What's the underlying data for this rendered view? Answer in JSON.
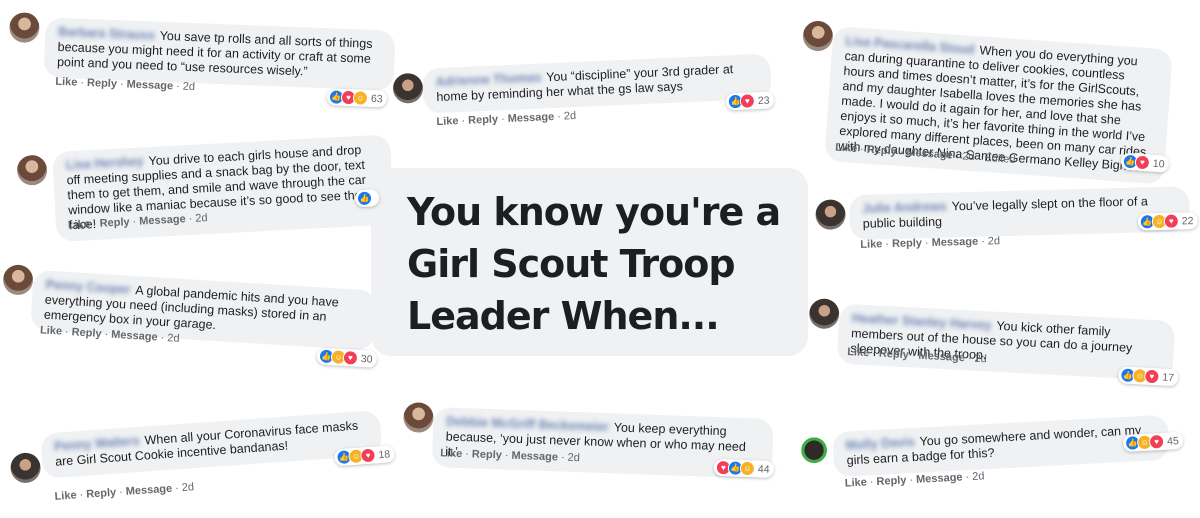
{
  "headline": [
    "You know you're a",
    "Girl Scout Troop",
    "Leader When..."
  ],
  "actions": {
    "like": "Like",
    "reply": "Reply",
    "message": "Message",
    "sep": "·"
  },
  "colors": {
    "like": "#1877f2",
    "love": "#f33e58",
    "haha": "#f7b125",
    "bubble": "#eff1f3"
  },
  "comments": [
    {
      "name": "Barbara Strauss",
      "text": "You save tp rolls and all sorts of things because you might need it for an activity or craft at some point and you need to “use resources wisely.”",
      "time": "2d",
      "reactions": [
        "like",
        "love",
        "haha"
      ],
      "count": "63"
    },
    {
      "name": "Adrienne Thomas",
      "text": "You “discipline” your 3rd grader at home by reminding her what the gs law says",
      "time": "2d",
      "reactions": [
        "like",
        "love"
      ],
      "count": "23"
    },
    {
      "name": "Lisa Pascarella Stoud",
      "text": "When you do everything you can during quarantine to deliver cookies, countless hours and times doesn’t matter, it’s for the GirlScouts, and my daughter Isabella loves the memories she has made. I would do it again for her, and love that she enjoys it so much, it’s her favorite thing in the world I’ve explored many different places, been on many car rides with my daughter Nina Santee Germano Kelley Bigness",
      "time": "2d · Edited",
      "reactions": [
        "like",
        "love"
      ],
      "count": "10"
    },
    {
      "name": "Lisa Hershey",
      "text": "You drive to each girls house and drop off meeting supplies and a snack bag by the door, text them to get them, and smile and wave through the car window like a maniac because it’s so good to see their face!",
      "time": "2d",
      "reactions": [
        "like"
      ],
      "count": ""
    },
    {
      "name": "Julie Andrews",
      "text": "You’ve legally slept on the floor of a public building",
      "time": "2d",
      "reactions": [
        "like",
        "haha",
        "love"
      ],
      "count": "22"
    },
    {
      "name": "Penny Cooper",
      "text": "A global pandemic hits and you have everything you need (including masks) stored in an emergency box in your garage.",
      "time": "2d",
      "reactions": [
        "like",
        "haha",
        "love"
      ],
      "count": "30"
    },
    {
      "name": "Heather Stanley Harvey",
      "text": "You kick other family members out of the house so you can do a journey sleepover with the troop.",
      "time": "2d",
      "reactions": [
        "like",
        "haha",
        "love"
      ],
      "count": "17"
    },
    {
      "name": "Penny Walters",
      "text": "When all your Coronavirus face masks are Girl Scout Cookie incentive bandanas!",
      "time": "2d",
      "reactions": [
        "like",
        "haha",
        "love"
      ],
      "count": "18"
    },
    {
      "name": "Debbie McGriff Beckemeier",
      "text": "You keep everything because, ‘you just never know when or who may need it.’",
      "time": "2d",
      "reactions": [
        "love",
        "like",
        "haha"
      ],
      "count": "44"
    },
    {
      "name": "Molly Davis",
      "text": "You go somewhere and wonder, can my girls earn a badge for this?",
      "time": "2d",
      "reactions": [
        "like",
        "haha",
        "love"
      ],
      "count": "45"
    }
  ]
}
